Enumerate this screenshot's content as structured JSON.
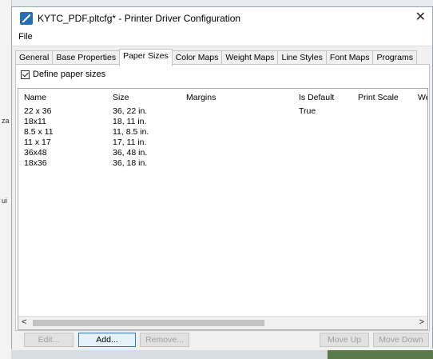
{
  "window": {
    "title": "KYTC_PDF.pltcfg* - Printer Driver Configuration",
    "close_glyph": "✕"
  },
  "menu": {
    "file": "File"
  },
  "tabs": [
    {
      "label": "General"
    },
    {
      "label": "Base Properties"
    },
    {
      "label": "Paper Sizes"
    },
    {
      "label": "Color Maps"
    },
    {
      "label": "Weight Maps"
    },
    {
      "label": "Line Styles"
    },
    {
      "label": "Font Maps"
    },
    {
      "label": "Programs"
    }
  ],
  "active_tab": "Paper Sizes",
  "define_paper_sizes": {
    "label": "Define paper sizes",
    "checked": true
  },
  "columns": [
    "Name",
    "Size",
    "Margins",
    "Is Default",
    "Print Scale",
    "Wei"
  ],
  "rows": [
    {
      "name": "22 x 36",
      "size": "36, 22 in.",
      "margins": "",
      "is_default": "True",
      "print_scale": ""
    },
    {
      "name": "18x11",
      "size": "18, 11 in.",
      "margins": "",
      "is_default": "",
      "print_scale": ""
    },
    {
      "name": "8.5 x 11",
      "size": "11, 8.5 in.",
      "margins": "",
      "is_default": "",
      "print_scale": ""
    },
    {
      "name": "11 x 17",
      "size": "17, 11 in.",
      "margins": "",
      "is_default": "",
      "print_scale": ""
    },
    {
      "name": "36x48",
      "size": "36, 48 in.",
      "margins": "",
      "is_default": "",
      "print_scale": ""
    },
    {
      "name": "18x36",
      "size": "36, 18 in.",
      "margins": "",
      "is_default": "",
      "print_scale": ""
    }
  ],
  "scroll": {
    "left_glyph": "<",
    "right_glyph": ">"
  },
  "buttons": {
    "edit": "Edit...",
    "add": "Add...",
    "remove": "Remove...",
    "move_up": "Move Up",
    "move_down": "Move Down"
  },
  "background_marks": [
    "za",
    "ui"
  ]
}
